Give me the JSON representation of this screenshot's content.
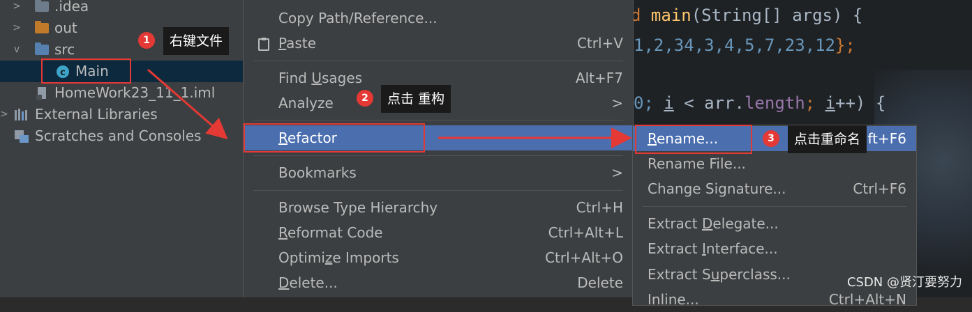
{
  "tree": {
    "items": [
      {
        "label": ".idea",
        "arrow": ">",
        "icon": "folder-icon",
        "color": "#6e7b8b"
      },
      {
        "label": "out",
        "arrow": ">",
        "icon": "folder-icon",
        "color": "#c07a2a"
      },
      {
        "label": "src",
        "arrow": "v",
        "icon": "folder-icon",
        "color": "#5580b0"
      },
      {
        "label": "Main",
        "icon": "java-class-icon",
        "color": "#3ea5c8"
      },
      {
        "label": "HomeWork23_11_1.iml",
        "icon": "module-file-icon"
      },
      {
        "label": "External Libraries",
        "arrow": ">",
        "icon": "library-icon"
      },
      {
        "label": "Scratches and Consoles",
        "icon": "scratch-icon"
      }
    ]
  },
  "editor": {
    "line1": {
      "before": "d ",
      "method": "main",
      "after": "(String[] args) {"
    },
    "line2": {
      "numbers": "1,2,34,3,4,5,7,23,12",
      "after": "};"
    },
    "line3": {
      "prefix": "0; ",
      "i1": "i",
      "mid": " < arr.",
      "field": "length",
      "semi": "; ",
      "i2": "i",
      "after": "++) {"
    }
  },
  "menu": {
    "copy_path": {
      "label": "Copy Path/Reference..."
    },
    "paste": {
      "label": "Paste",
      "shortcut": "Ctrl+V"
    },
    "find_usages": {
      "label": "Find Usages",
      "shortcut": "Alt+F7"
    },
    "analyze": {
      "label": "Analyze",
      "arrow": ">"
    },
    "refactor": {
      "label": "Refactor"
    },
    "bookmarks": {
      "label": "Bookmarks",
      "arrow": ">"
    },
    "browse_type_hierarchy": {
      "label": "Browse Type Hierarchy",
      "shortcut": "Ctrl+H"
    },
    "reformat_code": {
      "label": "Reformat Code",
      "shortcut": "Ctrl+Alt+L"
    },
    "optimize_imports": {
      "label": "Optimize Imports",
      "shortcut": "Ctrl+Alt+O"
    },
    "delete": {
      "label": "Delete...",
      "shortcut": "Delete"
    }
  },
  "submenu": {
    "rename": {
      "label": "Rename...",
      "shortcut": "ift+F6"
    },
    "rename_file": {
      "label": "Rename File..."
    },
    "change_signature": {
      "label": "Change Signature...",
      "shortcut": "Ctrl+F6"
    },
    "extract_delegate": {
      "label": "Extract Delegate..."
    },
    "extract_interface": {
      "label": "Extract Interface..."
    },
    "extract_superclass": {
      "label": "Extract Superclass..."
    },
    "inline": {
      "label": "Inline...",
      "shortcut": "Ctrl+Alt+N"
    }
  },
  "annotations": {
    "step1": {
      "num": "1",
      "text": "右键文件"
    },
    "step2": {
      "num": "2",
      "text": "点击 重构"
    },
    "step3": {
      "num": "3",
      "text": "点击重命名"
    }
  },
  "watermark": "CSDN @贤汀要努力",
  "colors": {
    "menu_bg": "#3c3f41",
    "highlight": "#4b6eaf",
    "annotation_red": "#e53935",
    "code_method": "#ffc66d",
    "code_number": "#6897bb",
    "code_keyword": "#cc7832",
    "code_field": "#9876aa"
  }
}
